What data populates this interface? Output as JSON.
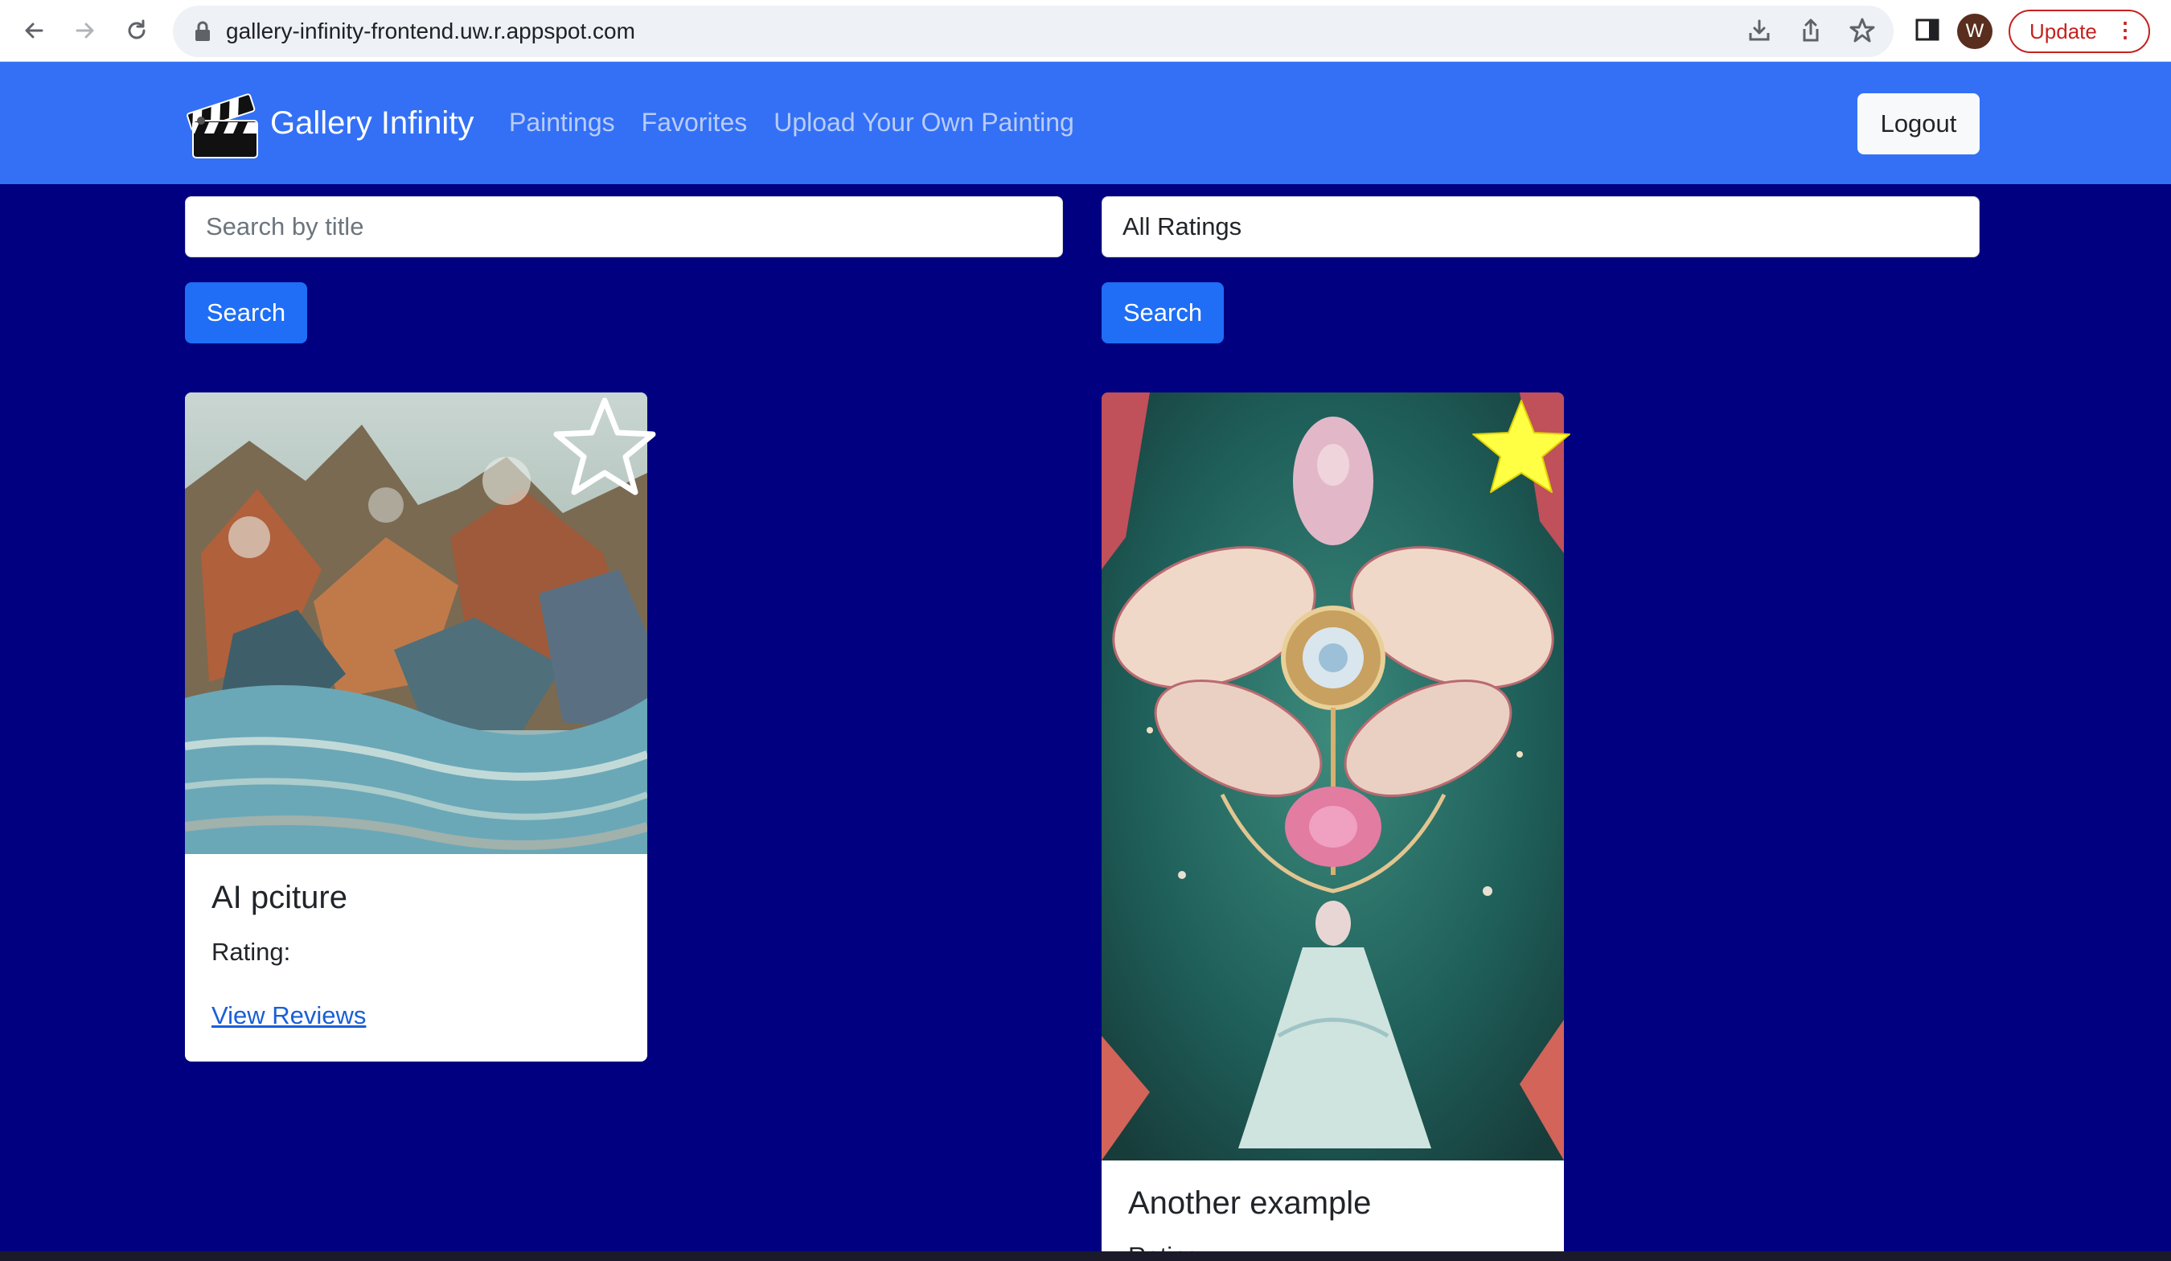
{
  "browser": {
    "url": "gallery-infinity-frontend.uw.r.appspot.com",
    "profile_initial": "W",
    "update_label": "Update",
    "icons": [
      "back-arrow-icon",
      "forward-arrow-icon",
      "reload-icon",
      "lock-icon",
      "install-icon",
      "share-icon",
      "bookmark-star-icon",
      "side-panel-icon",
      "kebab-menu-icon"
    ]
  },
  "navbar": {
    "brand": "Gallery Infinity",
    "brand_icon": "clapperboard-icon",
    "links": [
      "Paintings",
      "Favorites",
      "Upload Your Own Painting"
    ],
    "logout_label": "Logout",
    "color": "#3370f5"
  },
  "filters": {
    "search_placeholder": "Search by title",
    "rating_selected": "All Ratings",
    "search_button": "Search",
    "rating_search_button": "Search"
  },
  "paintings": [
    {
      "title": "AI pciture",
      "rating_label": "Rating:",
      "link": "View Reviews",
      "favorited": false
    },
    {
      "title": "Another example",
      "rating_label": "Rating:",
      "favorited": true
    }
  ],
  "colors": {
    "page_background": "#000080",
    "button_primary": "#1f6ef5",
    "favorite_star": "#ffff44"
  }
}
